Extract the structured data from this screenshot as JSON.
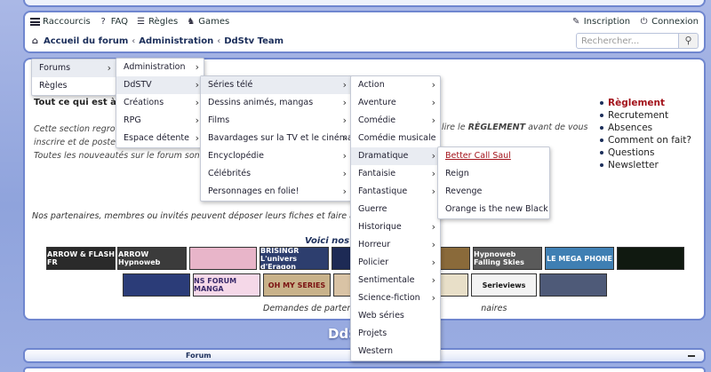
{
  "nav": {
    "raccourcis": "Raccourcis",
    "faq": "FAQ",
    "regles": "Règles",
    "games": "Games",
    "inscription": "Inscription",
    "connexion": "Connexion"
  },
  "breadcrumb": {
    "home": "Accueil du forum",
    "admin": "Administration",
    "team": "DdStv Team"
  },
  "search": {
    "placeholder": "Rechercher...",
    "button_icon": "magnifier-icon"
  },
  "menus": {
    "level1": [
      "Forums",
      "Règles"
    ],
    "level2": [
      "Administration",
      "DdSTV",
      "Créations",
      "RPG",
      "Espace détente"
    ],
    "level3": [
      "Séries télé",
      "Dessins animés, mangas",
      "Films",
      "Bavardages sur la TV et le cinéma",
      "Encyclopédie",
      "Célébrités",
      "Personnages en folie!"
    ],
    "level4": [
      "Action",
      "Aventure",
      "Comédie",
      "Comédie musicale",
      "Dramatique",
      "Fantaisie",
      "Fantastique",
      "Guerre",
      "Historique",
      "Horreur",
      "Policier",
      "Sentimentale",
      "Science-fiction",
      "Web séries",
      "Projets",
      "Western"
    ],
    "level5": [
      "Better Call Saul",
      "Reign",
      "Revenge",
      "Orange is the new Black"
    ]
  },
  "main": {
    "welcome_title": "Tout ce qui est à s",
    "intro_line1": "Cette section regrou",
    "intro_line2": "inscrire et de poster",
    "intro_line3": "Toutes les nouveautés sur le forum sont",
    "intro_right_prefix": "lire le ",
    "intro_right_bold": "RÈGLEMENT",
    "intro_right_suffix": " avant de vous",
    "side_links": [
      "Règlement",
      "Recrutement",
      "Absences",
      "Comment on fait?",
      "Questions",
      "Newsletter"
    ],
    "partners_text": "Nos partenaires, membres ou invités peuvent déposer leurs fiches et faire aut",
    "voici": "Voici nos T",
    "demandes_left": "Demandes de partena",
    "demandes_right": "naires"
  },
  "banners": {
    "arrow_flash": "ARROW & FLASH FR",
    "arrow": "ARROW Hypnoweb",
    "brisingr": "BRISINGR L'univers d'Eragon",
    "hypnoweb": "Hypnoweb Falling Skies",
    "lemega": "LE MEGA PHONE",
    "ns": "NS FORUM MANGA",
    "myseries": "OH MY SERIES",
    "serieviews": "Serieviews"
  },
  "footer": {
    "site_title": "DdS",
    "forum_label": "Forum"
  }
}
